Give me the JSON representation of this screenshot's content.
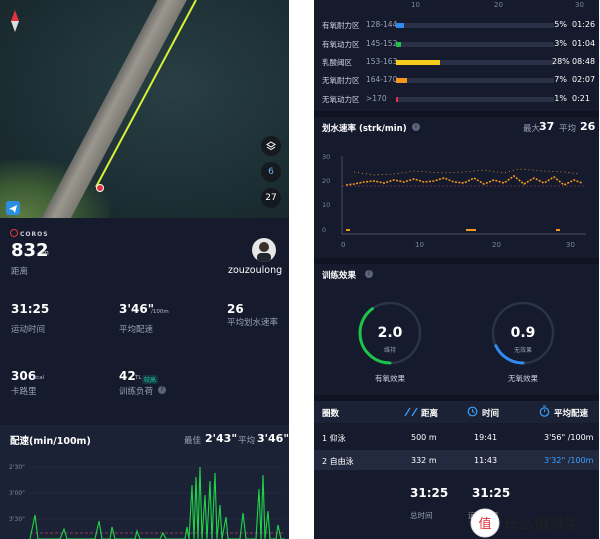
{
  "left": {
    "map": {
      "compass_icon": "compass-needle-icon",
      "layers_icon": "layers-icon",
      "zoom_level": "6",
      "temp": "27"
    },
    "brand": "COROS",
    "distance": {
      "value": "832",
      "unit": "m",
      "label": "距离"
    },
    "user": {
      "name": "zouzoulong"
    },
    "stats": [
      {
        "value": "31:25",
        "unit": "",
        "label": "运动时间"
      },
      {
        "value": "3'46\"",
        "unit": "/100m",
        "label": "平均配速"
      },
      {
        "value": "26",
        "unit": "",
        "label": "平均划水速率"
      },
      {
        "value": "306",
        "unit": "kcal",
        "label": "卡路里"
      },
      {
        "value": "42",
        "unit": "TL",
        "label": "训练负荷",
        "badge": "较高"
      }
    ],
    "pace": {
      "title": "配速(min/100m)",
      "best_label": "最佳",
      "best_value": "2'43\"",
      "avg_label": "平均",
      "avg_value": "3'46\"",
      "y_ticks": [
        "2'30\"",
        "3'00\"",
        "3'30\""
      ]
    }
  },
  "right": {
    "hr_axis_top": {
      "ticks": [
        "10",
        "20",
        "30"
      ]
    },
    "zones": [
      {
        "name": "有氧耐力区",
        "range": "128-144",
        "pct": "5%",
        "time": "01:26",
        "fill": 0.05,
        "color": "#2f8bf0"
      },
      {
        "name": "有氧动力区",
        "range": "145-152",
        "pct": "3%",
        "time": "01:04",
        "fill": 0.03,
        "color": "#1ec44a"
      },
      {
        "name": "乳酸阈区",
        "range": "153-163",
        "pct": "28%",
        "time": "08:48",
        "fill": 0.28,
        "color": "#f5cc1a"
      },
      {
        "name": "无氧耐力区",
        "range": "164-170",
        "pct": "7%",
        "time": "02:07",
        "fill": 0.07,
        "color": "#f5961e"
      },
      {
        "name": "无氧动力区",
        "range": ">170",
        "pct": "1%",
        "time": "0:21",
        "fill": 0.01,
        "color": "#e6324a"
      }
    ],
    "stroke": {
      "title": "划水速率 (strk/min)",
      "max_label": "最大",
      "max_value": "37",
      "avg_label": "平均",
      "avg_value": "26",
      "y_ticks": [
        "30",
        "20",
        "10",
        "0"
      ],
      "x_ticks": [
        "0",
        "10",
        "20",
        "30"
      ]
    },
    "effect": {
      "title": "训练效果",
      "aerobic": {
        "value": "2.0",
        "sub": "维持",
        "label": "有氧效果",
        "level": 0.4,
        "color": "#1ec44a"
      },
      "anaerobic": {
        "value": "0.9",
        "sub": "无效果",
        "label": "无氧效果",
        "level": 0.18,
        "color": "#2f8bf0"
      }
    },
    "laps": {
      "headers": {
        "lap": "圈数",
        "distance": "距离",
        "time": "时间",
        "pace": "平均配速"
      },
      "rows": [
        {
          "name": "1 仰泳",
          "distance": "500 m",
          "time": "19:41",
          "pace": "3'56\" /100m"
        },
        {
          "name": "2 自由泳",
          "distance": "332 m",
          "time": "11:43",
          "pace": "3'32\" /100m"
        }
      ]
    },
    "totals": {
      "time_a": "31:25",
      "label_a": "总时间",
      "time_b": "31:25",
      "label_b": "运动时间"
    },
    "watermark": "什么值得买"
  }
}
